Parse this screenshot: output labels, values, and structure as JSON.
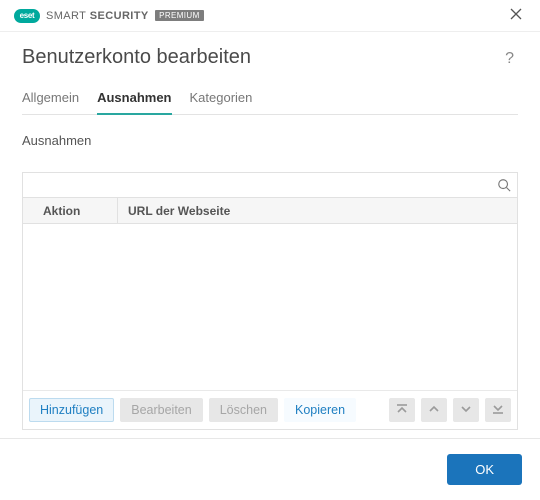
{
  "brand": {
    "logo_text": "eset",
    "name_thin": "SMART",
    "name_bold": "SECURITY",
    "badge": "PREMIUM"
  },
  "page_title": "Benutzerkonto bearbeiten",
  "tabs": {
    "general": "Allgemein",
    "exceptions": "Ausnahmen",
    "categories": "Kategorien"
  },
  "section_label": "Ausnahmen",
  "search": {
    "placeholder": ""
  },
  "table": {
    "col_action": "Aktion",
    "col_url": "URL der Webseite"
  },
  "toolbar": {
    "add": "Hinzufügen",
    "edit": "Bearbeiten",
    "delete": "Löschen",
    "copy": "Kopieren"
  },
  "footer": {
    "ok": "OK"
  }
}
